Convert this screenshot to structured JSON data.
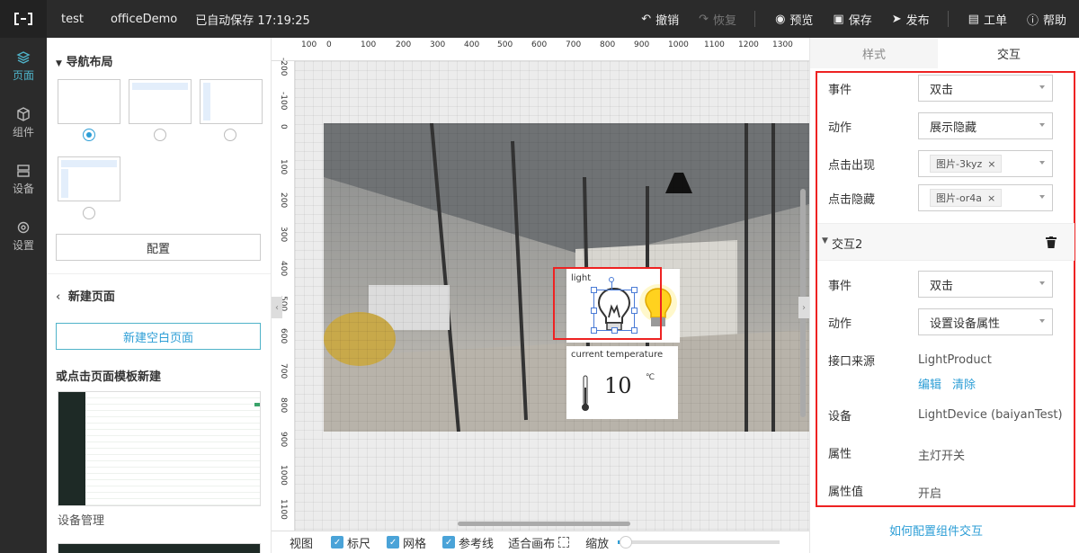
{
  "topbar": {
    "project": "test",
    "page": "officeDemo",
    "autosave": "已自动保存 17:19:25",
    "undo": "撤销",
    "redo": "恢复",
    "preview": "预览",
    "save": "保存",
    "publish": "发布",
    "ticket": "工单",
    "help": "帮助"
  },
  "leftnav": {
    "items": [
      {
        "label": "页面",
        "icon": "layers-icon",
        "active": true
      },
      {
        "label": "组件",
        "icon": "cube-icon"
      },
      {
        "label": "设备",
        "icon": "device-icon"
      },
      {
        "label": "设置",
        "icon": "gear-icon"
      }
    ]
  },
  "leftpanel": {
    "nav_layout_title": "导航布局",
    "selected_layout": 1,
    "config_button": "配置",
    "new_page_title": "新建页面",
    "new_blank_button": "新建空白页面",
    "template_title": "或点击页面模板新建",
    "template_name": "设备管理"
  },
  "canvas": {
    "ruler_h": [
      "100",
      "0",
      "100",
      "200",
      "300",
      "400",
      "500",
      "600",
      "700",
      "800",
      "900",
      "1000",
      "1100",
      "1200",
      "1300"
    ],
    "ruler_v": [
      "-200",
      "-100",
      "0",
      "100",
      "200",
      "300",
      "400",
      "500",
      "600",
      "700",
      "800",
      "900",
      "1000",
      "1100"
    ],
    "light_label": "light",
    "temp_label": "current temperature",
    "temp_value": "10",
    "temp_unit": "℃"
  },
  "bottombar": {
    "view": "视图",
    "ruler": "标尺",
    "grid": "网格",
    "guide": "参考线",
    "fit": "适合画布",
    "zoom": "缩放"
  },
  "rightpanel": {
    "tab_style": "样式",
    "tab_interaction": "交互",
    "interaction1": {
      "event_label": "事件",
      "event_value": "双击",
      "action_label": "动作",
      "action_value": "展示隐藏",
      "show_label": "点击出现",
      "show_tag": "图片-3kyz",
      "hide_label": "点击隐藏",
      "hide_tag": "图片-or4a"
    },
    "interaction2": {
      "title": "交互2",
      "event_label": "事件",
      "event_value": "双击",
      "action_label": "动作",
      "action_value": "设置设备属性",
      "source_label": "接口来源",
      "source_value": "LightProduct",
      "edit_link": "编辑",
      "clear_link": "清除",
      "device_label": "设备",
      "device_value": "LightDevice",
      "device_sub": "(baiyanTest)",
      "prop_label": "属性",
      "prop_value": "主灯开关",
      "propval_label": "属性值",
      "propval_value": "开启"
    },
    "help_link": "如何配置组件交互"
  },
  "colors": {
    "accent": "#2d9ed6",
    "highlight": "#e22222",
    "dark": "#2b2b2b"
  }
}
